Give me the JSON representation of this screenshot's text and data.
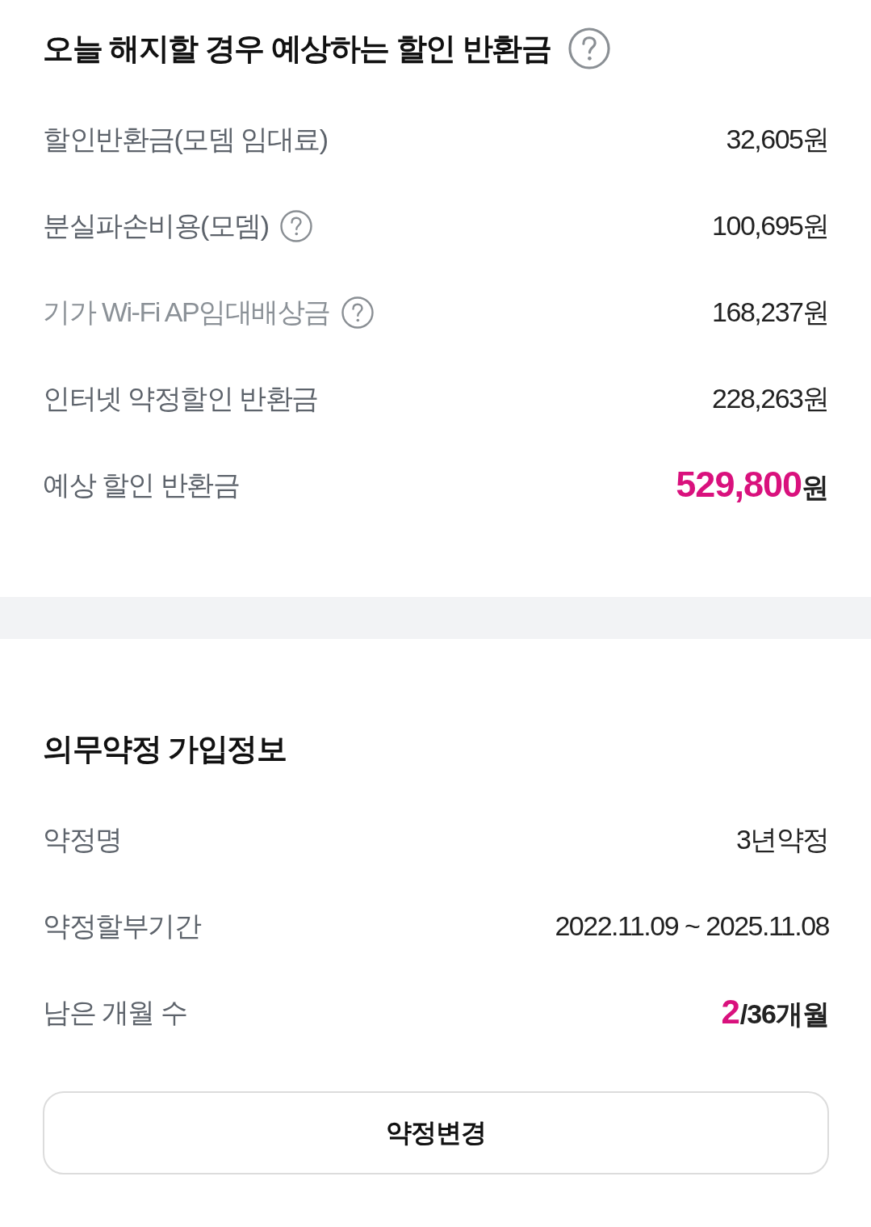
{
  "refund": {
    "title": "오늘 해지할 경우 예상하는 할인 반환금",
    "help": true,
    "rows": [
      {
        "kind": "plain",
        "label": "할인반환금(모뎀 임대료)",
        "help": false,
        "dimmed": false,
        "value": "32,605원"
      },
      {
        "kind": "plain",
        "label": "분실파손비용(모뎀)",
        "help": true,
        "dimmed": false,
        "value": "100,695원"
      },
      {
        "kind": "plain",
        "label": "기가 Wi-Fi AP임대배상금",
        "help": true,
        "dimmed": true,
        "value": "168,237원"
      },
      {
        "kind": "plain",
        "label": "인터넷 약정할인 반환금",
        "help": false,
        "dimmed": false,
        "value": "228,263원"
      },
      {
        "kind": "total",
        "label": "예상 할인 반환금",
        "help": false,
        "dimmed": false,
        "amount": "529,800",
        "unit": "원"
      }
    ]
  },
  "contract": {
    "title": "의무약정 가입정보",
    "rows": [
      {
        "kind": "plain",
        "label": "약정명",
        "value": "3년약정"
      },
      {
        "kind": "plain",
        "label": "약정할부기간",
        "value": "2022.11.09 ~ 2025.11.08"
      },
      {
        "kind": "count",
        "label": "남은 개월 수",
        "current": "2",
        "rest": "/36개월"
      }
    ],
    "button": "약정변경"
  }
}
